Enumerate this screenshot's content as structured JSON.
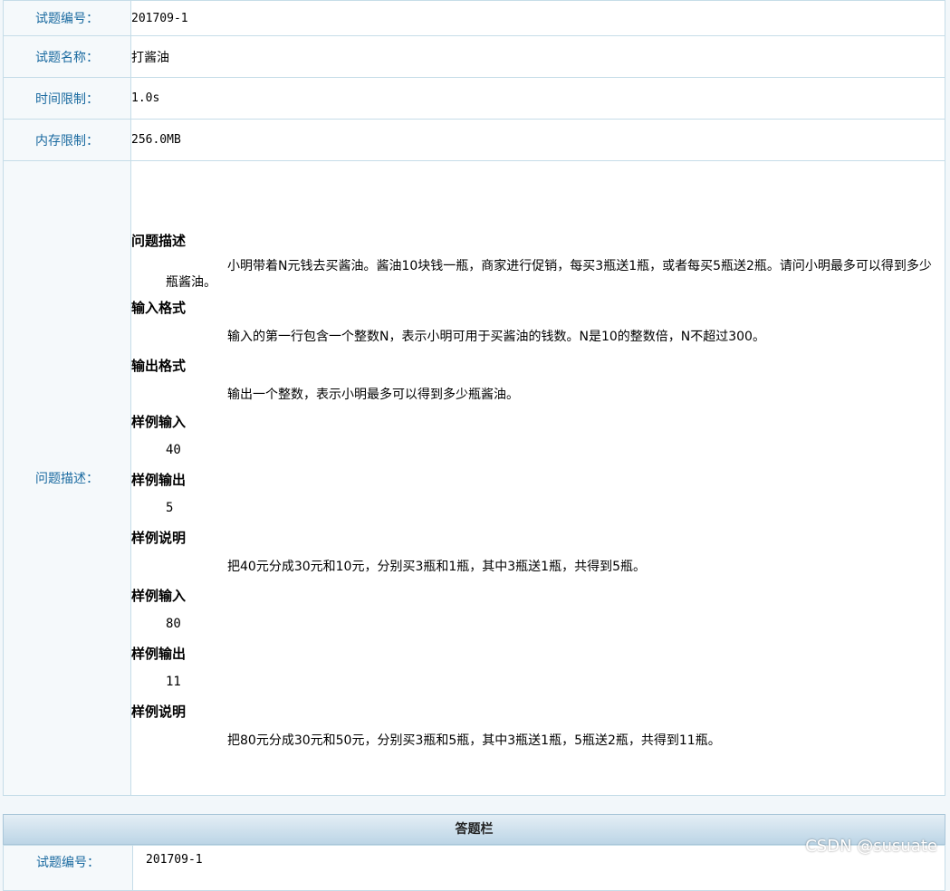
{
  "info": {
    "id_label": "试题编号：",
    "id_value": "201709-1",
    "name_label": "试题名称：",
    "name_value": "打酱油",
    "time_label": "时间限制：",
    "time_value": "1.0s",
    "mem_label": "内存限制：",
    "mem_value": "256.0MB",
    "desc_label": "问题描述："
  },
  "problem": {
    "desc_heading": "问题描述",
    "desc_text": "小明带着N元钱去买酱油。酱油10块钱一瓶，商家进行促销，每买3瓶送1瓶，或者每买5瓶送2瓶。请问小明最多可以得到多少瓶酱油。",
    "input_heading": "输入格式",
    "input_text": "输入的第一行包含一个整数N，表示小明可用于买酱油的钱数。N是10的整数倍，N不超过300。",
    "output_heading": "输出格式",
    "output_text": "输出一个整数，表示小明最多可以得到多少瓶酱油。",
    "samples": [
      {
        "input_heading": "样例输入",
        "input_value": "40",
        "output_heading": "样例输出",
        "output_value": "5",
        "explain_heading": "样例说明",
        "explain_text": "把40元分成30元和10元，分别买3瓶和1瓶，其中3瓶送1瓶，共得到5瓶。"
      },
      {
        "input_heading": "样例输入",
        "input_value": "80",
        "output_heading": "样例输出",
        "output_value": "11",
        "explain_heading": "样例说明",
        "explain_text": "把80元分成30元和50元，分别买3瓶和5瓶，其中3瓶送1瓶，5瓶送2瓶，共得到11瓶。"
      }
    ]
  },
  "answer_bar": {
    "title": "答题栏"
  },
  "answer": {
    "id_label": "试题编号：",
    "id_value": "201709-1"
  },
  "watermark": "CSDN @susuate"
}
